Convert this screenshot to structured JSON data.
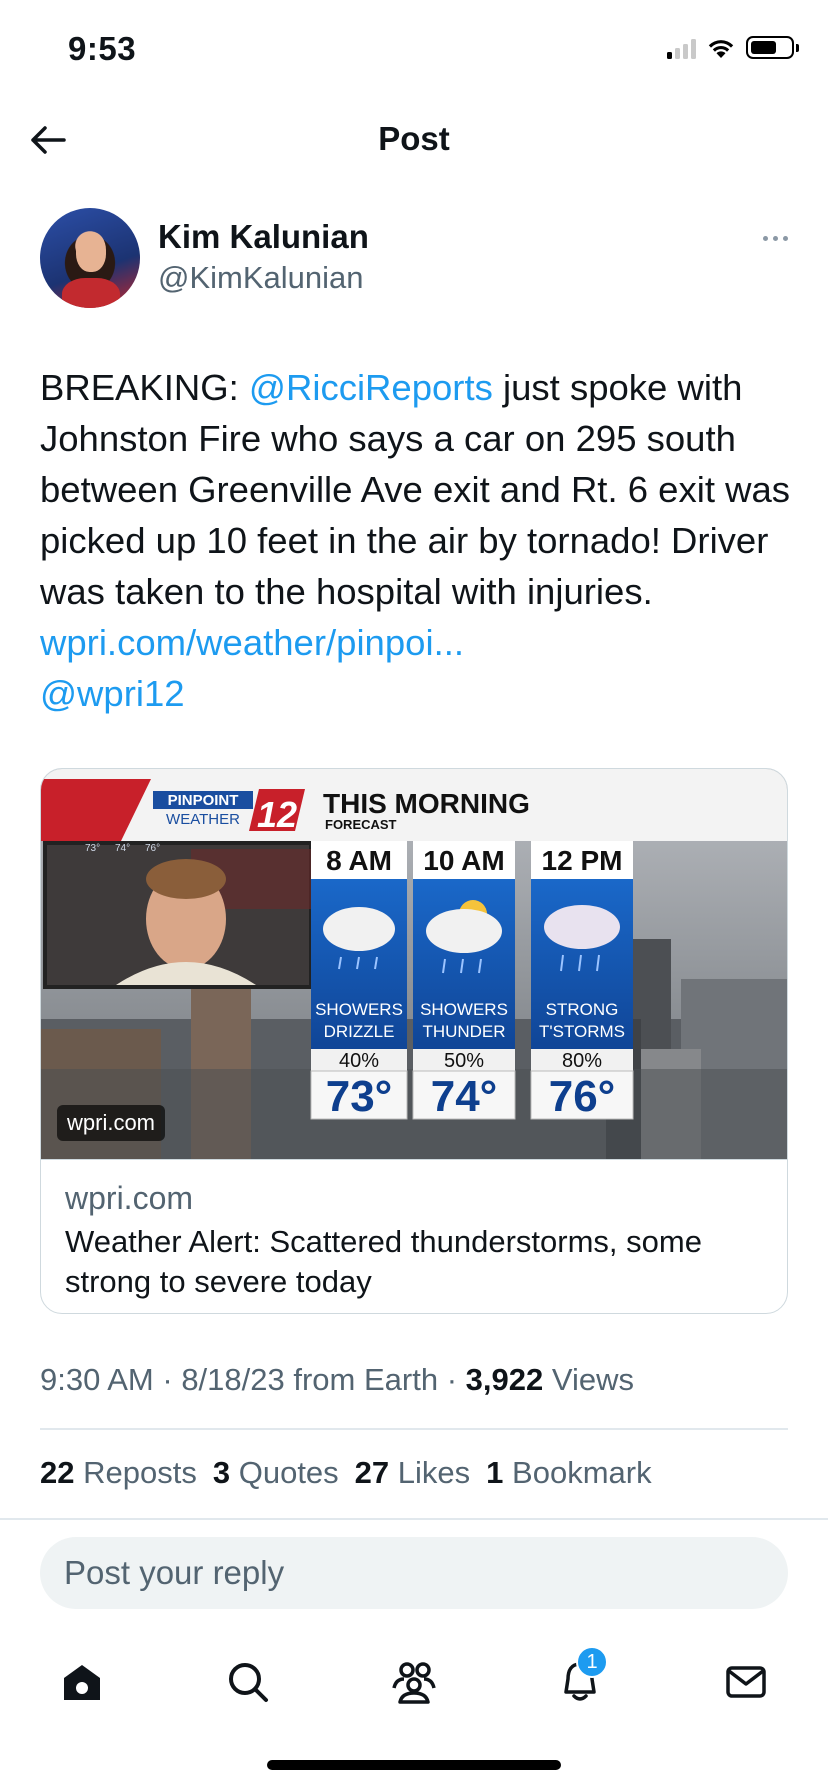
{
  "status_bar": {
    "time": "9:53"
  },
  "header": {
    "title": "Post"
  },
  "author": {
    "name": "Kim Kalunian",
    "handle": "@KimKalunian"
  },
  "post": {
    "text_prefix": "BREAKING: ",
    "mention": "@RicciReports",
    "text_body": " just spoke with Johnston Fire who says a car on 295 south between Greenville Ave exit and Rt. 6 exit was picked up 10 feet in the air by tornado! Driver was taken to the hospital with injuries. ",
    "url": "wpri.com/weather/pinpoi...",
    "mention2": "@wpri12"
  },
  "card": {
    "image_badge": "wpri.com",
    "domain": "wpri.com",
    "title": "Weather Alert: Scattered thunderstorms, some strong to severe today",
    "graphic": {
      "logo_top": "PINPOINT",
      "logo_bottom": "WEATHER",
      "logo_number": "12",
      "headline": "THIS MORNING",
      "subhead": "FORECAST",
      "inset_temps": [
        "73°",
        "74°",
        "76°"
      ],
      "columns": [
        {
          "time": "8 AM",
          "cond1": "SHOWERS",
          "cond2": "DRIZZLE",
          "pct": "40%",
          "temp": "73°"
        },
        {
          "time": "10 AM",
          "cond1": "SHOWERS",
          "cond2": "THUNDER",
          "pct": "50%",
          "temp": "74°"
        },
        {
          "time": "12 PM",
          "cond1": "STRONG",
          "cond2": "T'STORMS",
          "pct": "80%",
          "temp": "76°"
        }
      ]
    }
  },
  "meta": {
    "time": "9:30 AM",
    "date": "8/18/23",
    "source": "from Earth",
    "views_count": "3,922",
    "views_label": "Views"
  },
  "stats": {
    "reposts_count": "22",
    "reposts_label": "Reposts",
    "quotes_count": "3",
    "quotes_label": "Quotes",
    "likes_count": "27",
    "likes_label": "Likes",
    "bookmarks_count": "1",
    "bookmarks_label": "Bookmark"
  },
  "reply": {
    "placeholder": "Post your reply"
  },
  "tabs": {
    "home": "home-icon",
    "search": "search-icon",
    "communities": "communities-icon",
    "notifications": "bell-icon",
    "notifications_badge": "1",
    "messages": "mail-icon"
  },
  "colors": {
    "link": "#1d9bf0",
    "secondary_text": "#536471",
    "divider": "#e1e8ed"
  }
}
